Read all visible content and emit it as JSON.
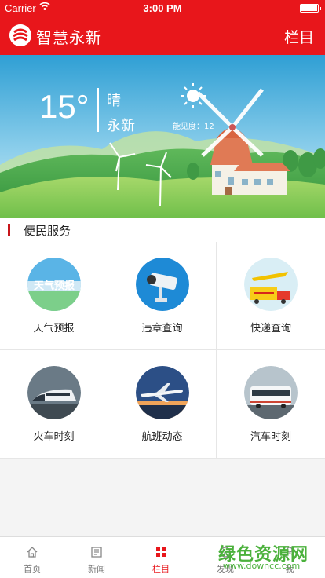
{
  "status_bar": {
    "carrier": "Carrier",
    "time": "3:00 PM"
  },
  "header": {
    "title": "智慧永新",
    "menu_label": "栏目"
  },
  "weather": {
    "temperature": "15°",
    "condition": "晴",
    "city": "永新",
    "visibility": "能见度：12"
  },
  "services": {
    "section_title": "便民服务",
    "items": [
      {
        "label": "天气预报",
        "icon": "weather-forecast-icon"
      },
      {
        "label": "违章查询",
        "icon": "traffic-camera-icon"
      },
      {
        "label": "快递查询",
        "icon": "delivery-truck-icon"
      },
      {
        "label": "火车时刻",
        "icon": "train-icon"
      },
      {
        "label": "航班动态",
        "icon": "airplane-icon"
      },
      {
        "label": "汽车时刻",
        "icon": "bus-icon"
      }
    ]
  },
  "tabbar": {
    "items": [
      {
        "label": "首页",
        "icon": "home-icon"
      },
      {
        "label": "新闻",
        "icon": "news-icon"
      },
      {
        "label": "栏目",
        "icon": "grid-icon",
        "active": true
      },
      {
        "label": "发现",
        "icon": "discover-icon"
      },
      {
        "label": "我",
        "icon": "user-icon"
      }
    ]
  },
  "watermark": {
    "text": "绿色资源网",
    "url": "www.downcc.com"
  },
  "colors": {
    "brand_red": "#e8161b",
    "watermark_green": "#4bb13c"
  }
}
